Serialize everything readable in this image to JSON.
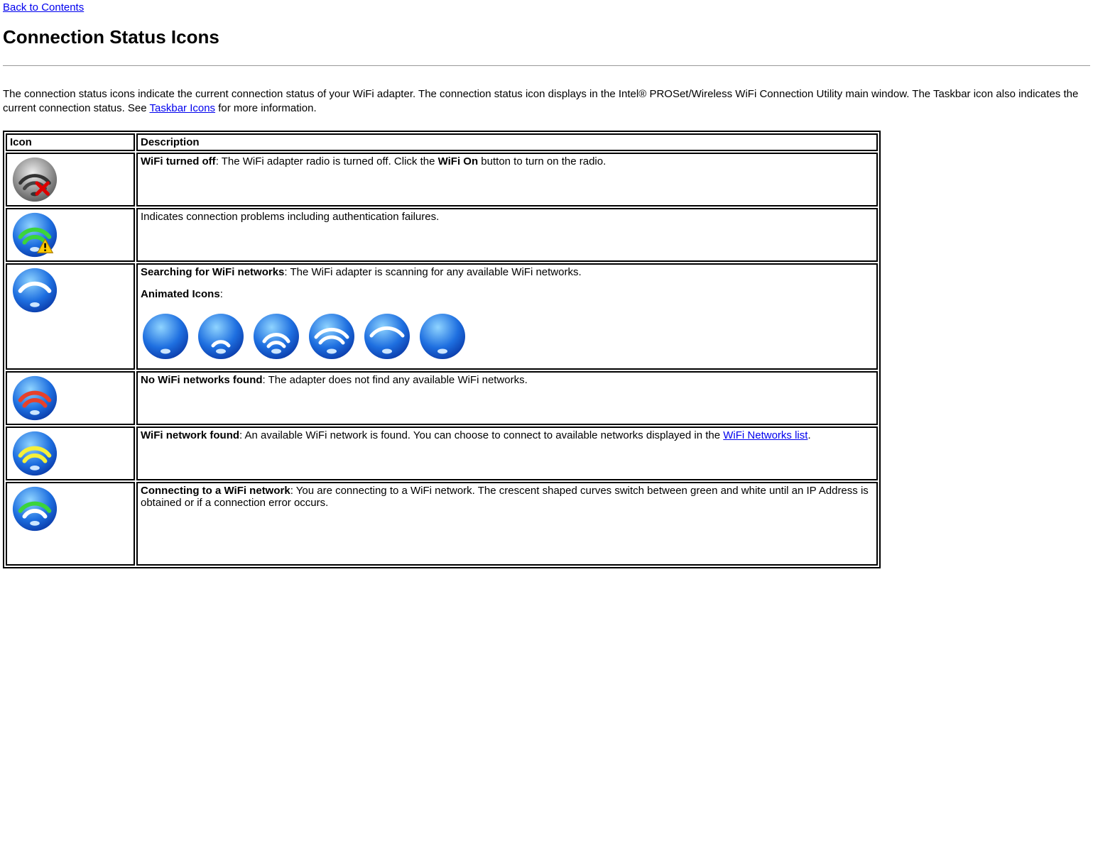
{
  "nav": {
    "back_link": "Back to Contents"
  },
  "title": "Connection Status Icons",
  "intro": {
    "text_before_link": "The connection status icons indicate the current connection status of your WiFi adapter. The connection status icon displays in the Intel® PROSet/Wireless WiFi Connection Utility main window. The Taskbar icon also indicates the current connection status. See ",
    "link": "Taskbar Icons",
    "text_after_link": " for more information."
  },
  "table": {
    "header_icon": "Icon",
    "header_desc": "Description",
    "rows": [
      {
        "bold": "WiFi turned off",
        "after_bold": ": The WiFi adapter radio is turned off. Click the ",
        "bold2": "WiFi On",
        "after_bold2": " button to turn on the radio."
      },
      {
        "plain": "Indicates connection problems including authentication failures."
      },
      {
        "bold": "Searching for WiFi networks",
        "after_bold": ": The WiFi adapter is scanning for any available WiFi networks.",
        "subhead": "Animated Icons",
        "subhead_after": ":"
      },
      {
        "bold": "No WiFi networks found",
        "after_bold": ": The adapter does not find any available WiFi networks."
      },
      {
        "bold": "WiFi network found",
        "after_bold": ": An available WiFi network is found. You can choose to connect to available networks displayed in the ",
        "link": "WiFi Networks list",
        "after_link": "."
      },
      {
        "bold": "Connecting to a WiFi network",
        "after_bold": ": You are connecting to a WiFi network. The crescent shaped curves switch between green and white until an IP Address is obtained or if a connection error occurs."
      }
    ]
  }
}
